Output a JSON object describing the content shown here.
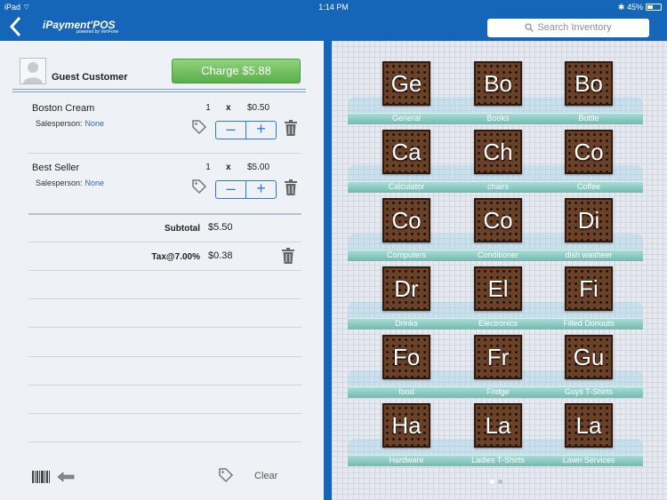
{
  "status_bar": {
    "device": "iPad",
    "time": "1:14 PM",
    "battery": "45%",
    "battery_level": 0.45
  },
  "nav": {
    "logo": "iPayment'POS",
    "logo_sub": "powered by VeriFone",
    "search_placeholder": "Search Inventory"
  },
  "cart": {
    "customer": "Guest Customer",
    "charge_label": "Charge $5.88",
    "items": [
      {
        "name": "Boston Cream",
        "qty": "1",
        "x": "x",
        "price": "$0.50",
        "salesperson_label": "Salesperson:",
        "salesperson": "None"
      },
      {
        "name": "Best Seller",
        "qty": "1",
        "x": "x",
        "price": "$5.00",
        "salesperson_label": "Salesperson:",
        "salesperson": "None"
      }
    ],
    "subtotal_label": "Subtotal",
    "subtotal": "$5.50",
    "tax_label": "Tax@7.00%",
    "tax": "$0.38",
    "clear_label": "Clear"
  },
  "inventory": {
    "categories": [
      {
        "abbr": "Ge",
        "label": "General"
      },
      {
        "abbr": "Bo",
        "label": "Books"
      },
      {
        "abbr": "Bo",
        "label": "Bottle"
      },
      {
        "abbr": "Ca",
        "label": "Calculator"
      },
      {
        "abbr": "Ch",
        "label": "chairs"
      },
      {
        "abbr": "Co",
        "label": "Coffee"
      },
      {
        "abbr": "Co",
        "label": "Computers"
      },
      {
        "abbr": "Co",
        "label": "Conditioner"
      },
      {
        "abbr": "Di",
        "label": "dish washeer"
      },
      {
        "abbr": "Dr",
        "label": "Drinks"
      },
      {
        "abbr": "El",
        "label": "Electronics"
      },
      {
        "abbr": "Fi",
        "label": "Filled Donuuts"
      },
      {
        "abbr": "Fo",
        "label": "food"
      },
      {
        "abbr": "Fr",
        "label": "Fridge"
      },
      {
        "abbr": "Gu",
        "label": "Guys T-Shirts"
      },
      {
        "abbr": "Ha",
        "label": "Hardware"
      },
      {
        "abbr": "La",
        "label": "Ladies T-Shirts"
      },
      {
        "abbr": "La",
        "label": "Lawn Services"
      }
    ]
  },
  "colors": {
    "brand": "#1565b8",
    "charge": "#5aaf4a",
    "accent": "#2f7ad1"
  }
}
